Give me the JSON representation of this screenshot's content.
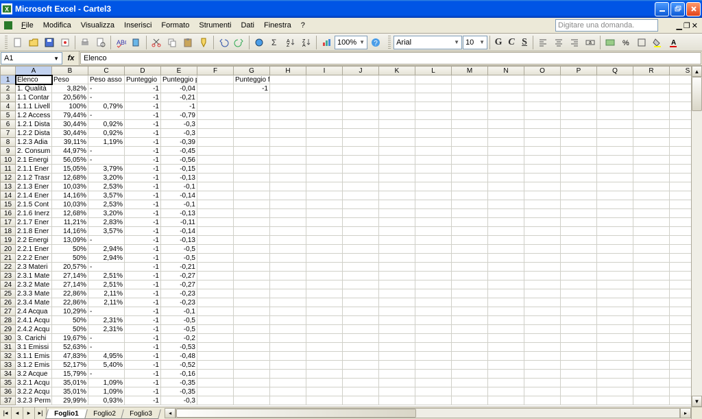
{
  "app": {
    "title": "Microsoft Excel - Cartel3"
  },
  "menu": {
    "file": "File",
    "modifica": "Modifica",
    "visualizza": "Visualizza",
    "inserisci": "Inserisci",
    "formato": "Formato",
    "strumenti": "Strumenti",
    "dati": "Dati",
    "finestra": "Finestra",
    "help": "?"
  },
  "askbox": "Digitare una domanda.",
  "toolbar": {
    "zoom": "100%",
    "font": "Arial",
    "size": "10"
  },
  "format_btns": {
    "bold": "G",
    "italic": "C",
    "underline": "S"
  },
  "namebox": "A1",
  "fx_label": "fx",
  "formula_value": "Elenco",
  "columns": [
    "A",
    "B",
    "C",
    "D",
    "E",
    "F",
    "G",
    "H",
    "I",
    "J",
    "K",
    "L",
    "M",
    "N",
    "O",
    "P",
    "Q",
    "R",
    "S"
  ],
  "headers": {
    "A": "Elenco",
    "B": "Peso",
    "C": "Peso asso",
    "D": "Punteggio",
    "E": "Punteggio pesato",
    "G": "Punteggio finale"
  },
  "rows": [
    {
      "n": 2,
      "A": "1. Qualità ",
      "B": "3,82%",
      "C": "-",
      "D": "-1",
      "E": "-0,04",
      "G": "-1"
    },
    {
      "n": 3,
      "A": "1.1 Contar",
      "B": "20,56%",
      "C": "-",
      "D": "-1",
      "E": "-0,21"
    },
    {
      "n": 4,
      "A": "1.1.1 Livell",
      "B": "100%",
      "C": "0,79%",
      "D": "-1",
      "E": "-1"
    },
    {
      "n": 5,
      "A": "1.2 Access",
      "B": "79,44%",
      "C": "-",
      "D": "-1",
      "E": "-0,79"
    },
    {
      "n": 6,
      "A": "1.2.1 Dista",
      "B": "30,44%",
      "C": "0,92%",
      "D": "-1",
      "E": "-0,3"
    },
    {
      "n": 7,
      "A": "1.2.2 Dista",
      "B": "30,44%",
      "C": "0,92%",
      "D": "-1",
      "E": "-0,3"
    },
    {
      "n": 8,
      "A": "1.2.3 Adia",
      "B": "39,11%",
      "C": "1,19%",
      "D": "-1",
      "E": "-0,39"
    },
    {
      "n": 9,
      "A": "2. Consum",
      "B": "44,97%",
      "C": "-",
      "D": "-1",
      "E": "-0,45"
    },
    {
      "n": 10,
      "A": "2.1 Energi",
      "B": "56,05%",
      "C": "-",
      "D": "-1",
      "E": "-0,56"
    },
    {
      "n": 11,
      "A": "2.1.1 Ener",
      "B": "15,05%",
      "C": "3,79%",
      "D": "-1",
      "E": "-0,15"
    },
    {
      "n": 12,
      "A": "2.1.2 Trasr",
      "B": "12,68%",
      "C": "3,20%",
      "D": "-1",
      "E": "-0,13"
    },
    {
      "n": 13,
      "A": "2.1.3 Ener",
      "B": "10,03%",
      "C": "2,53%",
      "D": "-1",
      "E": "-0,1"
    },
    {
      "n": 14,
      "A": "2.1.4 Ener",
      "B": "14,16%",
      "C": "3,57%",
      "D": "-1",
      "E": "-0,14"
    },
    {
      "n": 15,
      "A": "2.1.5 Cont",
      "B": "10,03%",
      "C": "2,53%",
      "D": "-1",
      "E": "-0,1"
    },
    {
      "n": 16,
      "A": "2.1.6 Inerz",
      "B": "12,68%",
      "C": "3,20%",
      "D": "-1",
      "E": "-0,13"
    },
    {
      "n": 17,
      "A": "2.1.7 Ener",
      "B": "11,21%",
      "C": "2,83%",
      "D": "-1",
      "E": "-0,11"
    },
    {
      "n": 18,
      "A": "2.1.8 Ener",
      "B": "14,16%",
      "C": "3,57%",
      "D": "-1",
      "E": "-0,14"
    },
    {
      "n": 19,
      "A": "2.2 Energi",
      "B": "13,09%",
      "C": "-",
      "D": "-1",
      "E": "-0,13"
    },
    {
      "n": 20,
      "A": "2.2.1 Ener",
      "B": "50%",
      "C": "2,94%",
      "D": "-1",
      "E": "-0,5"
    },
    {
      "n": 21,
      "A": "2.2.2 Ener",
      "B": "50%",
      "C": "2,94%",
      "D": "-1",
      "E": "-0,5"
    },
    {
      "n": 22,
      "A": "2.3 Materi",
      "B": "20,57%",
      "C": "-",
      "D": "-1",
      "E": "-0,21"
    },
    {
      "n": 23,
      "A": "2.3.1 Mate",
      "B": "27,14%",
      "C": "2,51%",
      "D": "-1",
      "E": "-0,27"
    },
    {
      "n": 24,
      "A": "2.3.2 Mate",
      "B": "27,14%",
      "C": "2,51%",
      "D": "-1",
      "E": "-0,27"
    },
    {
      "n": 25,
      "A": "2.3.3 Mate",
      "B": "22,86%",
      "C": "2,11%",
      "D": "-1",
      "E": "-0,23"
    },
    {
      "n": 26,
      "A": "2.3.4 Mate",
      "B": "22,86%",
      "C": "2,11%",
      "D": "-1",
      "E": "-0,23"
    },
    {
      "n": 27,
      "A": "2.4 Acqua",
      "B": "10,29%",
      "C": "-",
      "D": "-1",
      "E": "-0,1"
    },
    {
      "n": 28,
      "A": "2.4.1 Acqu",
      "B": "50%",
      "C": "2,31%",
      "D": "-1",
      "E": "-0,5"
    },
    {
      "n": 29,
      "A": "2.4.2 Acqu",
      "B": "50%",
      "C": "2,31%",
      "D": "-1",
      "E": "-0,5"
    },
    {
      "n": 30,
      "A": "3. Carichi ",
      "B": "19,67%",
      "C": "-",
      "D": "-1",
      "E": "-0,2"
    },
    {
      "n": 31,
      "A": "3.1 Emissi",
      "B": "52,63%",
      "C": "-",
      "D": "-1",
      "E": "-0,53"
    },
    {
      "n": 32,
      "A": "3.1.1 Emis",
      "B": "47,83%",
      "C": "4,95%",
      "D": "-1",
      "E": "-0,48"
    },
    {
      "n": 33,
      "A": "3.1.2 Emis",
      "B": "52,17%",
      "C": "5,40%",
      "D": "-1",
      "E": "-0,52"
    },
    {
      "n": 34,
      "A": "3.2 Acque",
      "B": "15,79%",
      "C": "-",
      "D": "-1",
      "E": "-0,16"
    },
    {
      "n": 35,
      "A": "3.2.1 Acqu",
      "B": "35,01%",
      "C": "1,09%",
      "D": "-1",
      "E": "-0,35"
    },
    {
      "n": 36,
      "A": "3.2.2 Acqu",
      "B": "35,01%",
      "C": "1,09%",
      "D": "-1",
      "E": "-0,35"
    },
    {
      "n": 37,
      "A": "3.2.3 Perm",
      "B": "29,99%",
      "C": "0,93%",
      "D": "-1",
      "E": "-0,3"
    }
  ],
  "sheets": {
    "active": "Foglio1",
    "tabs": [
      "Foglio1",
      "Foglio2",
      "Foglio3"
    ]
  }
}
